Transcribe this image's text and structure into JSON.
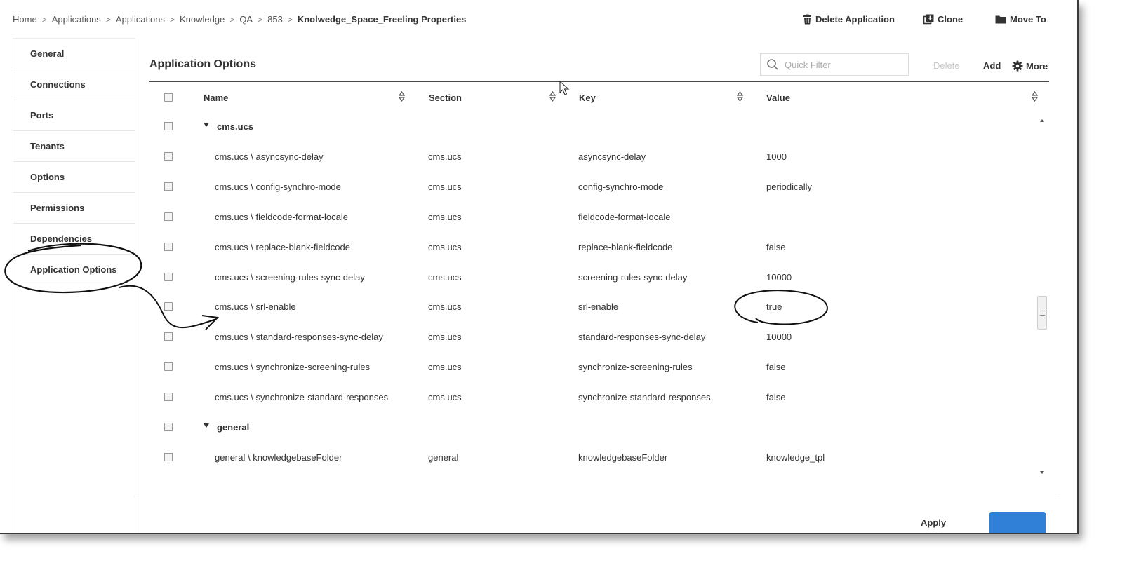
{
  "breadcrumb": [
    "Home",
    "Applications",
    "Applications",
    "Knowledge",
    "QA",
    "853"
  ],
  "breadcrumb_current": "Knolwedge_Space_Freeling Properties",
  "toolbar": {
    "delete": "Delete Application",
    "clone": "Clone",
    "move": "Move To"
  },
  "sidebar": {
    "items": [
      {
        "label": "General"
      },
      {
        "label": "Connections"
      },
      {
        "label": "Ports"
      },
      {
        "label": "Tenants"
      },
      {
        "label": "Options"
      },
      {
        "label": "Permissions"
      },
      {
        "label": "Dependencies"
      },
      {
        "label": "Application Options"
      }
    ],
    "active": "Application Options"
  },
  "panel": {
    "title": "Application Options",
    "filter_placeholder": "Quick Filter",
    "delete": "Delete",
    "add": "Add",
    "more": "More"
  },
  "table": {
    "columns": [
      "Name",
      "Section",
      "Key",
      "Value"
    ],
    "rows": [
      {
        "type": "group",
        "name": "cms.ucs"
      },
      {
        "type": "item",
        "name": "cms.ucs \\ asyncsync-delay",
        "section": "cms.ucs",
        "key": "asyncsync-delay",
        "value": "1000"
      },
      {
        "type": "item",
        "name": "cms.ucs \\ config-synchro-mode",
        "section": "cms.ucs",
        "key": "config-synchro-mode",
        "value": "periodically"
      },
      {
        "type": "item",
        "name": "cms.ucs \\ fieldcode-format-locale",
        "section": "cms.ucs",
        "key": "fieldcode-format-locale",
        "value": ""
      },
      {
        "type": "item",
        "name": "cms.ucs \\ replace-blank-fieldcode",
        "section": "cms.ucs",
        "key": "replace-blank-fieldcode",
        "value": "false"
      },
      {
        "type": "item",
        "name": "cms.ucs \\ screening-rules-sync-delay",
        "section": "cms.ucs",
        "key": "screening-rules-sync-delay",
        "value": "10000"
      },
      {
        "type": "item",
        "name": "cms.ucs \\ srl-enable",
        "section": "cms.ucs",
        "key": "srl-enable",
        "value": "true"
      },
      {
        "type": "item",
        "name": "cms.ucs \\ standard-responses-sync-delay",
        "section": "cms.ucs",
        "key": "standard-responses-sync-delay",
        "value": "10000"
      },
      {
        "type": "item",
        "name": "cms.ucs \\ synchronize-screening-rules",
        "section": "cms.ucs",
        "key": "synchronize-screening-rules",
        "value": "false"
      },
      {
        "type": "item",
        "name": "cms.ucs \\ synchronize-standard-responses",
        "section": "cms.ucs",
        "key": "synchronize-standard-responses",
        "value": "false"
      },
      {
        "type": "group",
        "name": "general"
      },
      {
        "type": "item",
        "name": "general \\ knowledgebaseFolder",
        "section": "general",
        "key": "knowledgebaseFolder",
        "value": "knowledge_tpl"
      }
    ]
  },
  "footer": {
    "apply": "Apply",
    "save": ""
  },
  "colors": {
    "accent": "#2f80d6",
    "header_rule": "#4a4a4a",
    "annotation": "#111111"
  }
}
